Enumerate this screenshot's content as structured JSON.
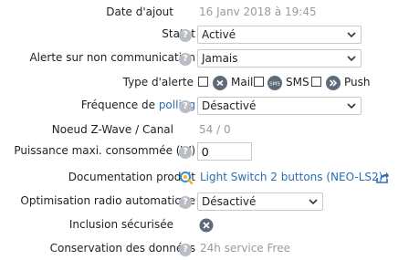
{
  "date_ajout": {
    "label": "Date d'ajout",
    "value": "16 Janv 2018 à 19:45"
  },
  "statut": {
    "label": "Statut",
    "value": "Activé"
  },
  "alerte_non_comm": {
    "label": "Alerte sur non communication",
    "value": "Jamais"
  },
  "type_alerte": {
    "label": "Type d'alerte",
    "options": [
      {
        "label": "Mail",
        "checked": false
      },
      {
        "label": "SMS",
        "checked": false,
        "badge_text": "SMS"
      },
      {
        "label": "Push",
        "checked": false
      }
    ]
  },
  "frequence": {
    "label_prefix": "Fréquence de ",
    "label_link": "polling",
    "value": "Désactivé"
  },
  "noeud": {
    "label": "Noeud Z-Wave / Canal",
    "value": "54 / 0"
  },
  "puissance": {
    "label": "Puissance maxi. consommée (W)",
    "value": "0"
  },
  "documentation": {
    "label": "Documentation produit",
    "link_text": "Light Switch 2 buttons (NEO-LS2)"
  },
  "optimisation": {
    "label": "Optimisation radio automatique",
    "value": "Désactivé"
  },
  "inclusion": {
    "label": "Inclusion sécurisée",
    "state": "off"
  },
  "conservation": {
    "label": "Conservation des données",
    "value": "24h service Free"
  },
  "colors": {
    "link": "#2a6fb3",
    "help_badge": "#b9bec4",
    "select_border": "#c9c9c9",
    "muted_text": "#9a9a9a"
  }
}
